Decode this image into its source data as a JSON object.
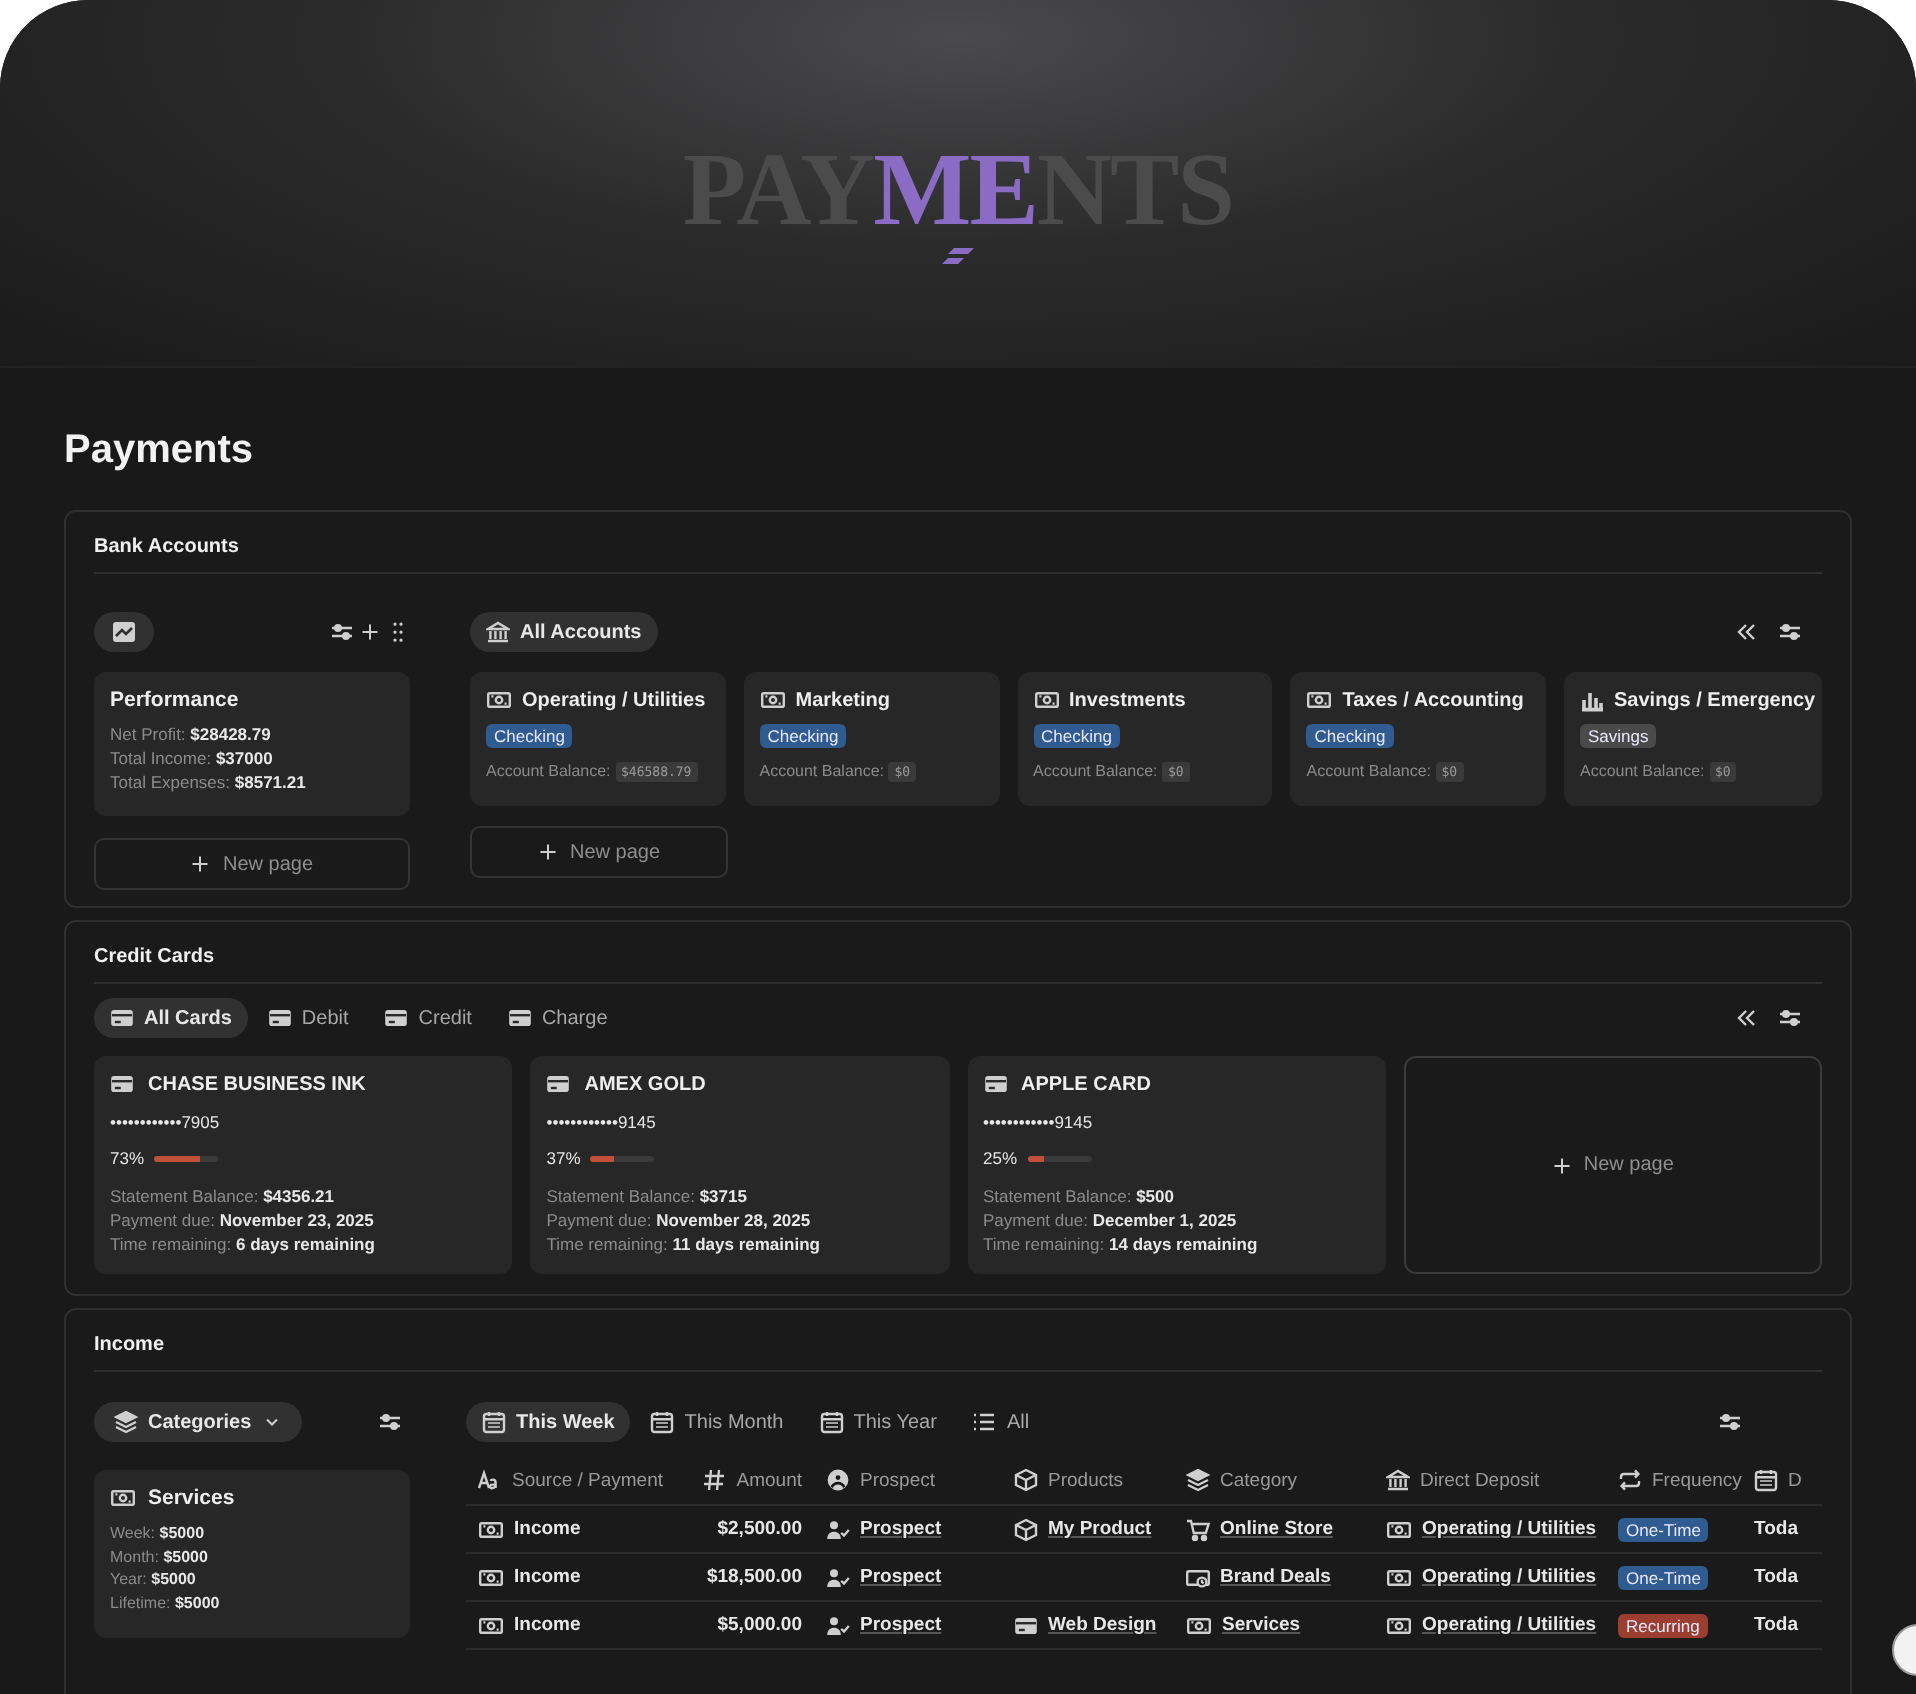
{
  "banner": {
    "parts": [
      {
        "text": "PAY",
        "accent": false
      },
      {
        "text": "ME",
        "accent": true
      },
      {
        "text": "NTS",
        "accent": false
      }
    ]
  },
  "page_title": "Payments",
  "bank_accounts": {
    "title": "Bank Accounts",
    "performance": {
      "title": "Performance",
      "lines": [
        {
          "label": "Net Profit:",
          "value": "$28428.79"
        },
        {
          "label": "Total Income:",
          "value": "$37000"
        },
        {
          "label": "Total Expenses:",
          "value": "$8571.21"
        }
      ]
    },
    "left_new_page": "New page",
    "tabs": [
      {
        "label": "All Accounts",
        "selected": true
      }
    ],
    "accounts": [
      {
        "name": "Operating / Utilities",
        "kind": "bill",
        "tag": "Checking",
        "color": "#2f5b91",
        "balance_label": "Account Balance:",
        "balance": "$46588.79"
      },
      {
        "name": "Marketing",
        "kind": "bill",
        "tag": "Checking",
        "color": "#2f5b91",
        "balance_label": "Account Balance:",
        "balance": "$0"
      },
      {
        "name": "Investments",
        "kind": "bill",
        "tag": "Checking",
        "color": "#2f5b91",
        "balance_label": "Account Balance:",
        "balance": "$0"
      },
      {
        "name": "Taxes / Accounting",
        "kind": "bill",
        "tag": "Checking",
        "color": "#2f5b91",
        "balance_label": "Account Balance:",
        "balance": "$0"
      },
      {
        "name": "Savings / Emergency",
        "kind": "chart",
        "tag": "Savings",
        "color": "#4a4a4a",
        "balance_label": "Account Balance:",
        "balance": "$0"
      }
    ],
    "new_page": "New page"
  },
  "credit_cards": {
    "title": "Credit Cards",
    "tabs": [
      {
        "label": "All Cards",
        "selected": true
      },
      {
        "label": "Debit",
        "selected": false
      },
      {
        "label": "Credit",
        "selected": false
      },
      {
        "label": "Charge",
        "selected": false
      }
    ],
    "cards": [
      {
        "name": "CHASE BUSINESS INK",
        "number": "••••••••••••7905",
        "percent": "73%",
        "level": 0.73,
        "balance_label": "Statement Balance:",
        "balance": "$4356.21",
        "due_label": "Payment due:",
        "due": "November 23, 2025",
        "remaining_label": "Time remaining:",
        "remaining": "6 days remaining"
      },
      {
        "name": "AMEX GOLD",
        "number": "••••••••••••9145",
        "percent": "37%",
        "level": 0.37,
        "balance_label": "Statement Balance:",
        "balance": "$3715",
        "due_label": "Payment due:",
        "due": "November 28, 2025",
        "remaining_label": "Time remaining:",
        "remaining": "11 days remaining"
      },
      {
        "name": "APPLE CARD",
        "number": "••••••••••••9145",
        "percent": "25%",
        "level": 0.25,
        "balance_label": "Statement Balance:",
        "balance": "$500",
        "due_label": "Payment due:",
        "due": "December 1, 2025",
        "remaining_label": "Time remaining:",
        "remaining": "14 days remaining"
      }
    ],
    "new_page": "New page"
  },
  "income": {
    "title": "Income",
    "categories_button": "Categories",
    "category_card": {
      "title": "Services",
      "lines": [
        {
          "label": "Week:",
          "value": "$5000"
        },
        {
          "label": "Month:",
          "value": "$5000"
        },
        {
          "label": "Year:",
          "value": "$5000"
        },
        {
          "label": "Lifetime:",
          "value": "$5000"
        }
      ]
    },
    "tabs": [
      {
        "label": "This Week",
        "kind": "week",
        "selected": true
      },
      {
        "label": "This Month",
        "kind": "month",
        "selected": false
      },
      {
        "label": "This Year",
        "kind": "year",
        "selected": false
      },
      {
        "label": "All",
        "kind": "list",
        "selected": false
      }
    ],
    "columns": [
      {
        "label": "Source / Payment",
        "kind": "text"
      },
      {
        "label": "Amount",
        "kind": "number"
      },
      {
        "label": "Prospect",
        "kind": "person"
      },
      {
        "label": "Products",
        "kind": "box"
      },
      {
        "label": "Category",
        "kind": "stack"
      },
      {
        "label": "Direct Deposit",
        "kind": "bank"
      },
      {
        "label": "Frequency",
        "kind": "repeat"
      },
      {
        "label": "D",
        "kind": "date"
      }
    ],
    "rows": [
      {
        "source": "Income",
        "amount": "$2,500.00",
        "prospect": "Prospect",
        "product": {
          "name": "My Product",
          "kind": "box"
        },
        "category": {
          "name": "Online Store",
          "kind": "cart"
        },
        "deposit": "Operating / Utilities",
        "frequency": {
          "text": "One-Time",
          "color": "#2f5b91"
        },
        "column_8": "Toda"
      },
      {
        "source": "Income",
        "amount": "$18,500.00",
        "prospect": "Prospect",
        "category": {
          "name": "Brand Deals",
          "kind": "tag"
        },
        "deposit": "Operating / Utilities",
        "frequency": {
          "text": "One-Time",
          "color": "#2f5b91"
        },
        "column_8": "Toda"
      },
      {
        "source": "Income",
        "amount": "$5,000.00",
        "prospect": "Prospect",
        "product": {
          "name": "Web Design",
          "kind": "card"
        },
        "category": {
          "name": "Services",
          "kind": "bill"
        },
        "deposit": "Operating / Utilities",
        "frequency": {
          "text": "Recurring",
          "color": "#9b3d2f"
        },
        "column_8": "Toda"
      }
    ]
  }
}
